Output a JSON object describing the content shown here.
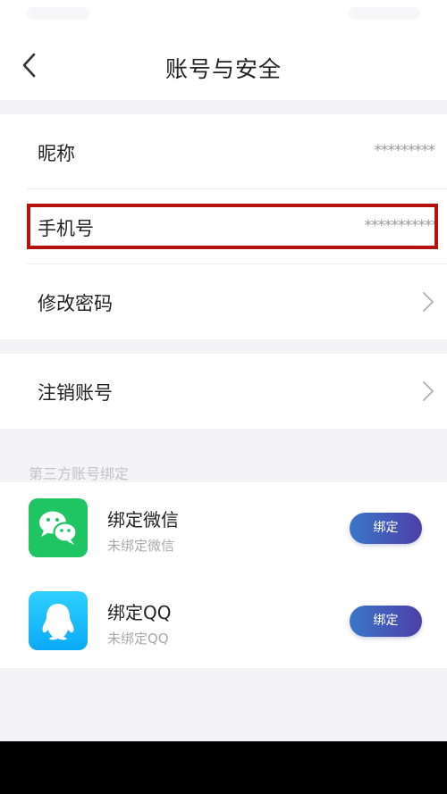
{
  "header": {
    "title": "账号与安全"
  },
  "account": {
    "nickname": {
      "label": "昵称",
      "value": "*********"
    },
    "phone": {
      "label": "手机号",
      "value": "***********"
    },
    "password": {
      "label": "修改密码"
    },
    "cancel": {
      "label": "注销账号"
    }
  },
  "third_party": {
    "section_title": "第三方账号绑定",
    "items": [
      {
        "title": "绑定微信",
        "status": "未绑定微信",
        "button": "绑定",
        "icon": "wechat-icon"
      },
      {
        "title": "绑定QQ",
        "status": "未绑定QQ",
        "button": "绑定",
        "icon": "qq-icon"
      }
    ]
  },
  "colors": {
    "highlight": "#b3120d",
    "wechat": "#1fc463",
    "qq": "#0ba9f5",
    "button_gradient_start": "#3a77c8",
    "button_gradient_end": "#4c3fa8"
  }
}
